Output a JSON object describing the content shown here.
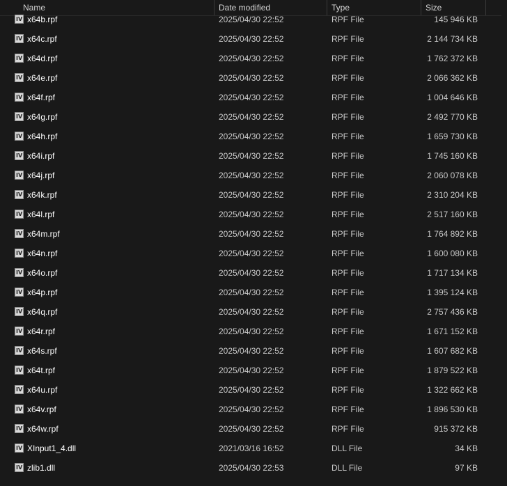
{
  "columns": {
    "name": "Name",
    "date": "Date modified",
    "type": "Type",
    "size": "Size"
  },
  "files": [
    {
      "name": "x64b.rpf",
      "date": "2025/04/30 22:52",
      "type": "RPF File",
      "size": "145 946 KB"
    },
    {
      "name": "x64c.rpf",
      "date": "2025/04/30 22:52",
      "type": "RPF File",
      "size": "2 144 734 KB"
    },
    {
      "name": "x64d.rpf",
      "date": "2025/04/30 22:52",
      "type": "RPF File",
      "size": "1 762 372 KB"
    },
    {
      "name": "x64e.rpf",
      "date": "2025/04/30 22:52",
      "type": "RPF File",
      "size": "2 066 362 KB"
    },
    {
      "name": "x64f.rpf",
      "date": "2025/04/30 22:52",
      "type": "RPF File",
      "size": "1 004 646 KB"
    },
    {
      "name": "x64g.rpf",
      "date": "2025/04/30 22:52",
      "type": "RPF File",
      "size": "2 492 770 KB"
    },
    {
      "name": "x64h.rpf",
      "date": "2025/04/30 22:52",
      "type": "RPF File",
      "size": "1 659 730 KB"
    },
    {
      "name": "x64i.rpf",
      "date": "2025/04/30 22:52",
      "type": "RPF File",
      "size": "1 745 160 KB"
    },
    {
      "name": "x64j.rpf",
      "date": "2025/04/30 22:52",
      "type": "RPF File",
      "size": "2 060 078 KB"
    },
    {
      "name": "x64k.rpf",
      "date": "2025/04/30 22:52",
      "type": "RPF File",
      "size": "2 310 204 KB"
    },
    {
      "name": "x64l.rpf",
      "date": "2025/04/30 22:52",
      "type": "RPF File",
      "size": "2 517 160 KB"
    },
    {
      "name": "x64m.rpf",
      "date": "2025/04/30 22:52",
      "type": "RPF File",
      "size": "1 764 892 KB"
    },
    {
      "name": "x64n.rpf",
      "date": "2025/04/30 22:52",
      "type": "RPF File",
      "size": "1 600 080 KB"
    },
    {
      "name": "x64o.rpf",
      "date": "2025/04/30 22:52",
      "type": "RPF File",
      "size": "1 717 134 KB"
    },
    {
      "name": "x64p.rpf",
      "date": "2025/04/30 22:52",
      "type": "RPF File",
      "size": "1 395 124 KB"
    },
    {
      "name": "x64q.rpf",
      "date": "2025/04/30 22:52",
      "type": "RPF File",
      "size": "2 757 436 KB"
    },
    {
      "name": "x64r.rpf",
      "date": "2025/04/30 22:52",
      "type": "RPF File",
      "size": "1 671 152 KB"
    },
    {
      "name": "x64s.rpf",
      "date": "2025/04/30 22:52",
      "type": "RPF File",
      "size": "1 607 682 KB"
    },
    {
      "name": "x64t.rpf",
      "date": "2025/04/30 22:52",
      "type": "RPF File",
      "size": "1 879 522 KB"
    },
    {
      "name": "x64u.rpf",
      "date": "2025/04/30 22:52",
      "type": "RPF File",
      "size": "1 322 662 KB"
    },
    {
      "name": "x64v.rpf",
      "date": "2025/04/30 22:52",
      "type": "RPF File",
      "size": "1 896 530 KB"
    },
    {
      "name": "x64w.rpf",
      "date": "2025/04/30 22:52",
      "type": "RPF File",
      "size": "915 372 KB"
    },
    {
      "name": "XInput1_4.dll",
      "date": "2021/03/16 16:52",
      "type": "DLL File",
      "size": "34 KB"
    },
    {
      "name": "zlib1.dll",
      "date": "2025/04/30 22:53",
      "type": "DLL File",
      "size": "97 KB"
    }
  ]
}
